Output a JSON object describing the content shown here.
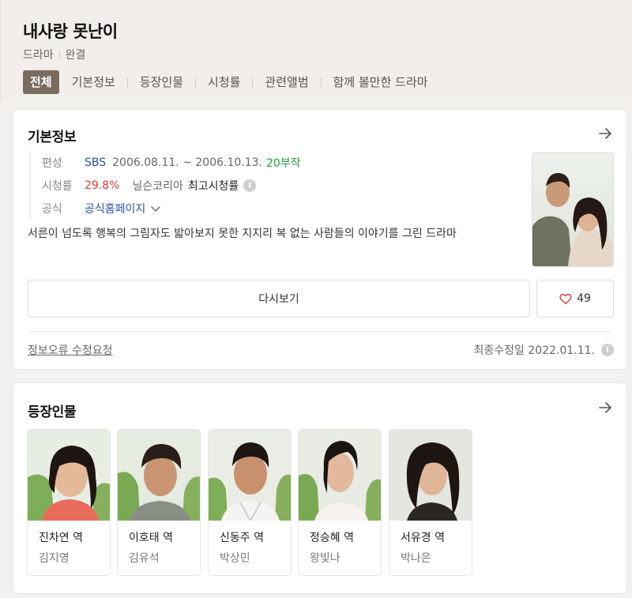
{
  "header": {
    "title": "내사랑 못난이",
    "genre": "드라마",
    "status": "완결"
  },
  "tabs": [
    {
      "label": "전체",
      "active": true
    },
    {
      "label": "기본정보"
    },
    {
      "label": "등장인물"
    },
    {
      "label": "시청률"
    },
    {
      "label": "관련앨범"
    },
    {
      "label": "함께 볼만한 드라마"
    }
  ],
  "basic_info": {
    "section_title": "기본정보",
    "broadcast_label": "편성",
    "channel": "SBS",
    "dates": "2006.08.11. ~ 2006.10.13.",
    "episodes": "20부작",
    "rating_label": "시청률",
    "rating_value": "29.8%",
    "rating_source": "닐슨코리아",
    "rating_type": "최고시청률",
    "official_label": "공식",
    "official_link": "공식홈페이지",
    "description": "서른이 넘도록 행복의 그림자도 밟아보지 못한 지지리 복 없는 사람들의 이야기를 그린 드라마",
    "replay_button": "다시보기",
    "like_count": "49",
    "report_link": "정보오류 수정요청",
    "updated": "최종수정일 2022.01.11."
  },
  "cast_section": {
    "section_title": "등장인물",
    "members": [
      {
        "role": "진차연 역",
        "actor": "김지영"
      },
      {
        "role": "이호태 역",
        "actor": "김유석"
      },
      {
        "role": "신동주 역",
        "actor": "박상민"
      },
      {
        "role": "정승혜 역",
        "actor": "왕빛나"
      },
      {
        "role": "서유경 역",
        "actor": "박나은"
      }
    ]
  },
  "colors": {
    "active_tab": "#7a6b5e",
    "link_blue": "#2a52a8",
    "rating_red": "#d43c3c",
    "episode_green": "#1f9e3a"
  }
}
